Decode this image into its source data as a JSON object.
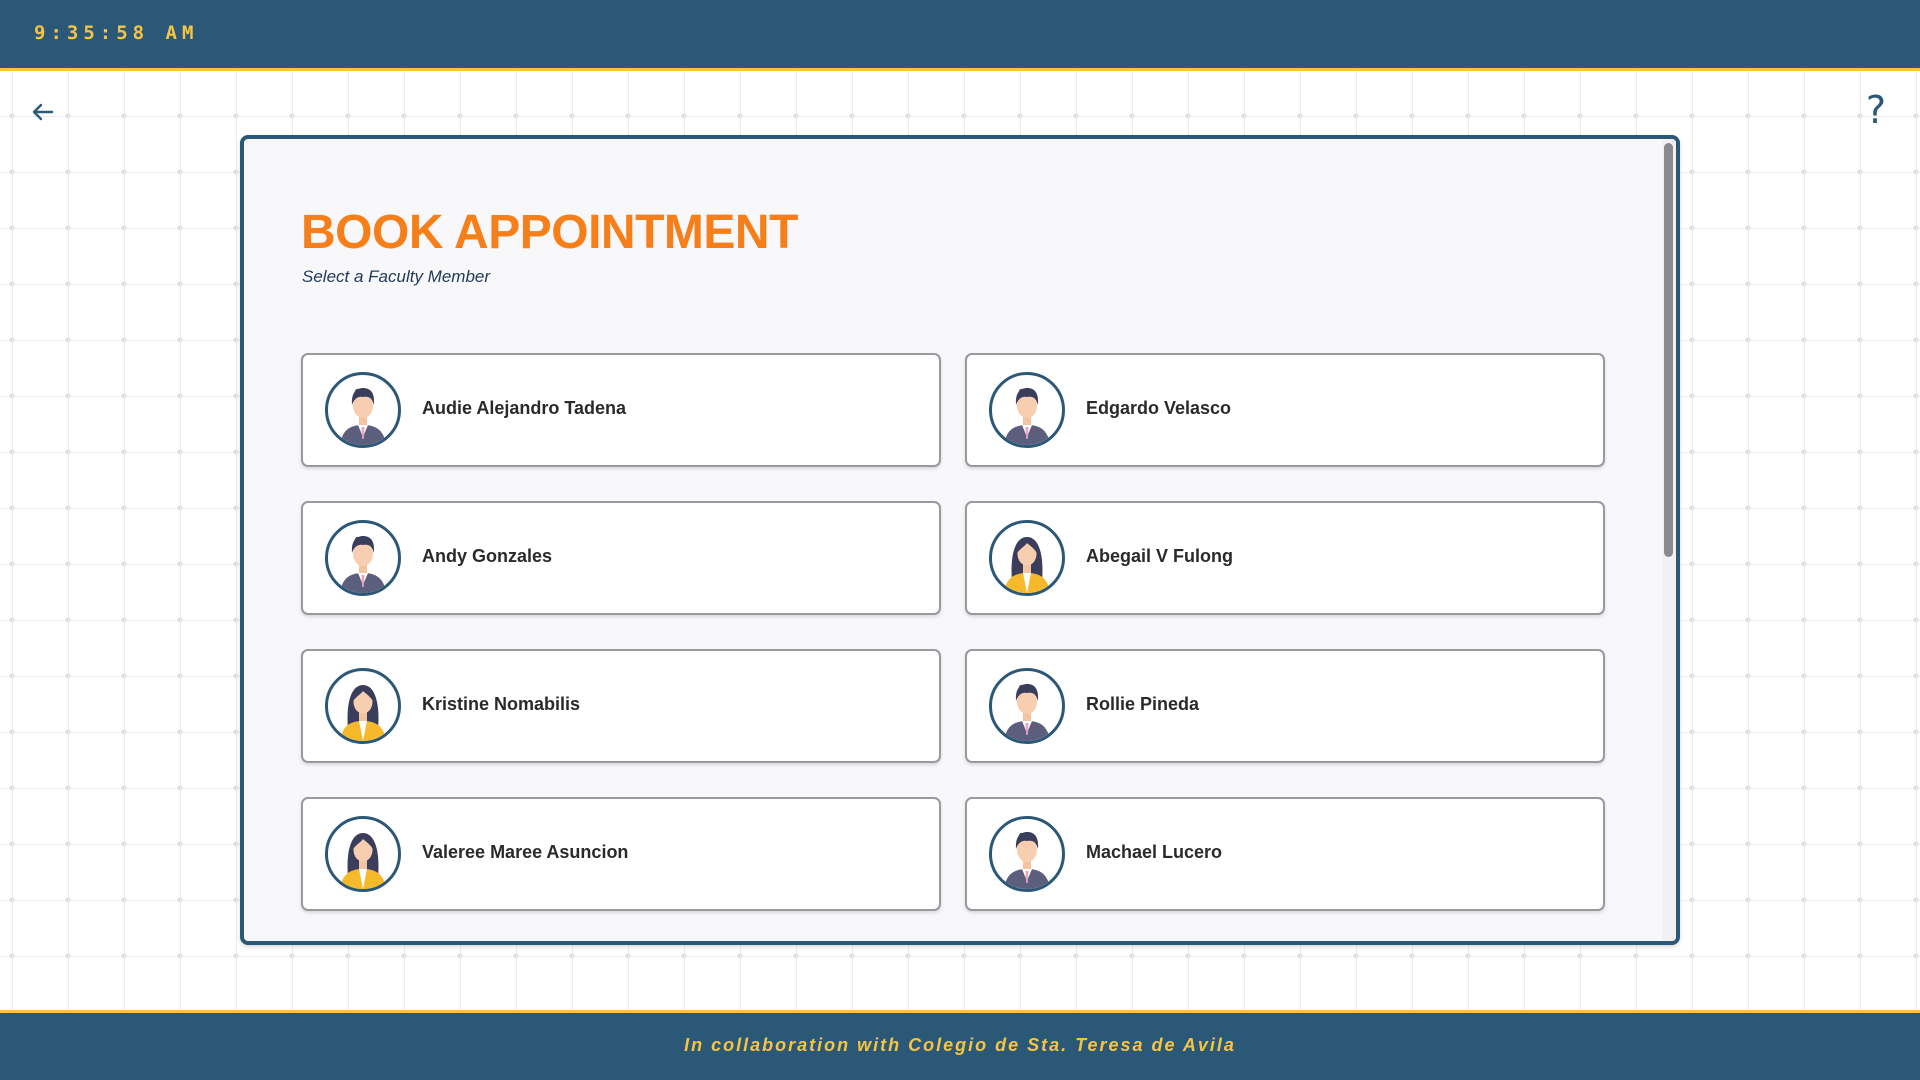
{
  "header": {
    "clock": "9:35:58 AM"
  },
  "nav": {
    "back_icon": "arrow-left-icon",
    "help_label": "?"
  },
  "page": {
    "title": "BOOK APPOINTMENT",
    "subtitle": "Select a Faculty Member"
  },
  "faculty": [
    {
      "name": "Audie Alejandro Tadena",
      "avatar": "male-avatar-icon"
    },
    {
      "name": "Edgardo Velasco",
      "avatar": "male-avatar-icon"
    },
    {
      "name": "Andy Gonzales",
      "avatar": "male-avatar-icon"
    },
    {
      "name": "Abegail V Fulong",
      "avatar": "female-avatar-icon"
    },
    {
      "name": "Kristine Nomabilis",
      "avatar": "female-avatar-icon"
    },
    {
      "name": "Rollie Pineda",
      "avatar": "male-avatar-icon"
    },
    {
      "name": "Valeree Maree Asuncion",
      "avatar": "female-avatar-icon"
    },
    {
      "name": "Machael Lucero",
      "avatar": "male-avatar-icon"
    }
  ],
  "footer": {
    "text": "In collaboration with Colegio de Sta. Teresa de Avila"
  },
  "colors": {
    "primary": "#2c5878",
    "accent": "#f5c542",
    "title": "#f77f1a"
  }
}
